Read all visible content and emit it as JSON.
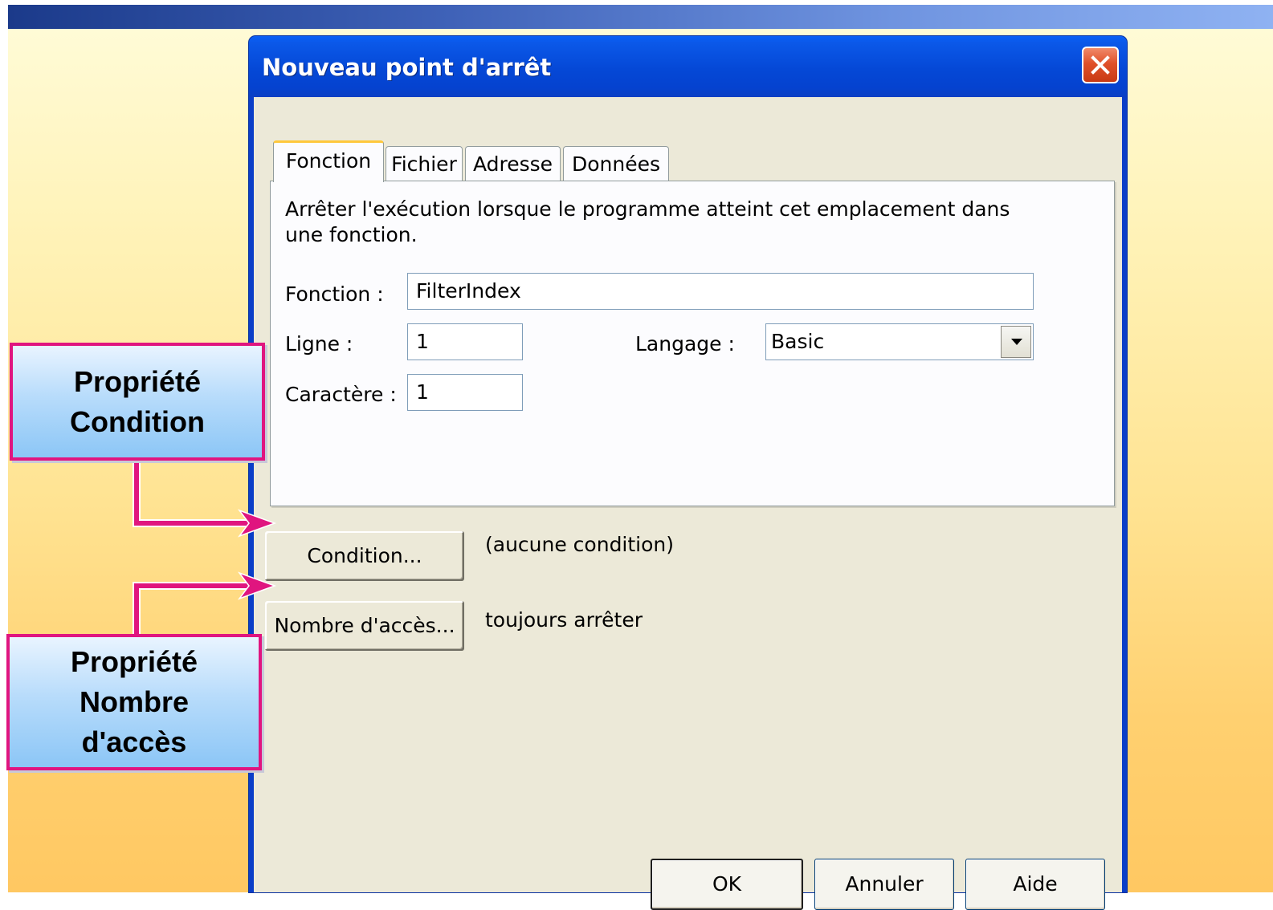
{
  "dialog": {
    "title": "Nouveau point d'arrêt",
    "tabs": [
      {
        "label": "Fonction",
        "active": true
      },
      {
        "label": "Fichier",
        "active": false
      },
      {
        "label": "Adresse",
        "active": false
      },
      {
        "label": "Données",
        "active": false
      }
    ],
    "description": "Arrêter l'exécution lorsque le programme atteint cet emplacement dans une fonction.",
    "fields": {
      "fonction": {
        "label": "Fonction :",
        "value": "FilterIndex"
      },
      "ligne": {
        "label": "Ligne :",
        "value": "1"
      },
      "langage": {
        "label": "Langage :",
        "value": "Basic"
      },
      "caractere": {
        "label": "Caractère :",
        "value": "1"
      }
    },
    "condition": {
      "button": "Condition...",
      "status": "(aucune condition)"
    },
    "hit_count": {
      "button": "Nombre d'accès...",
      "status": "toujours arrêter"
    },
    "footer": {
      "ok": "OK",
      "cancel": "Annuler",
      "help": "Aide"
    }
  },
  "callouts": {
    "condition": "Propriété Condition",
    "hit_count": "Propriété Nombre d'accès"
  },
  "colors": {
    "accent_callout_border": "#e0157f",
    "titlebar_blue": "#0548d6",
    "dialog_face": "#ece9d8"
  },
  "icons": {
    "close": "close-icon",
    "dropdown": "chevron-down-icon"
  }
}
